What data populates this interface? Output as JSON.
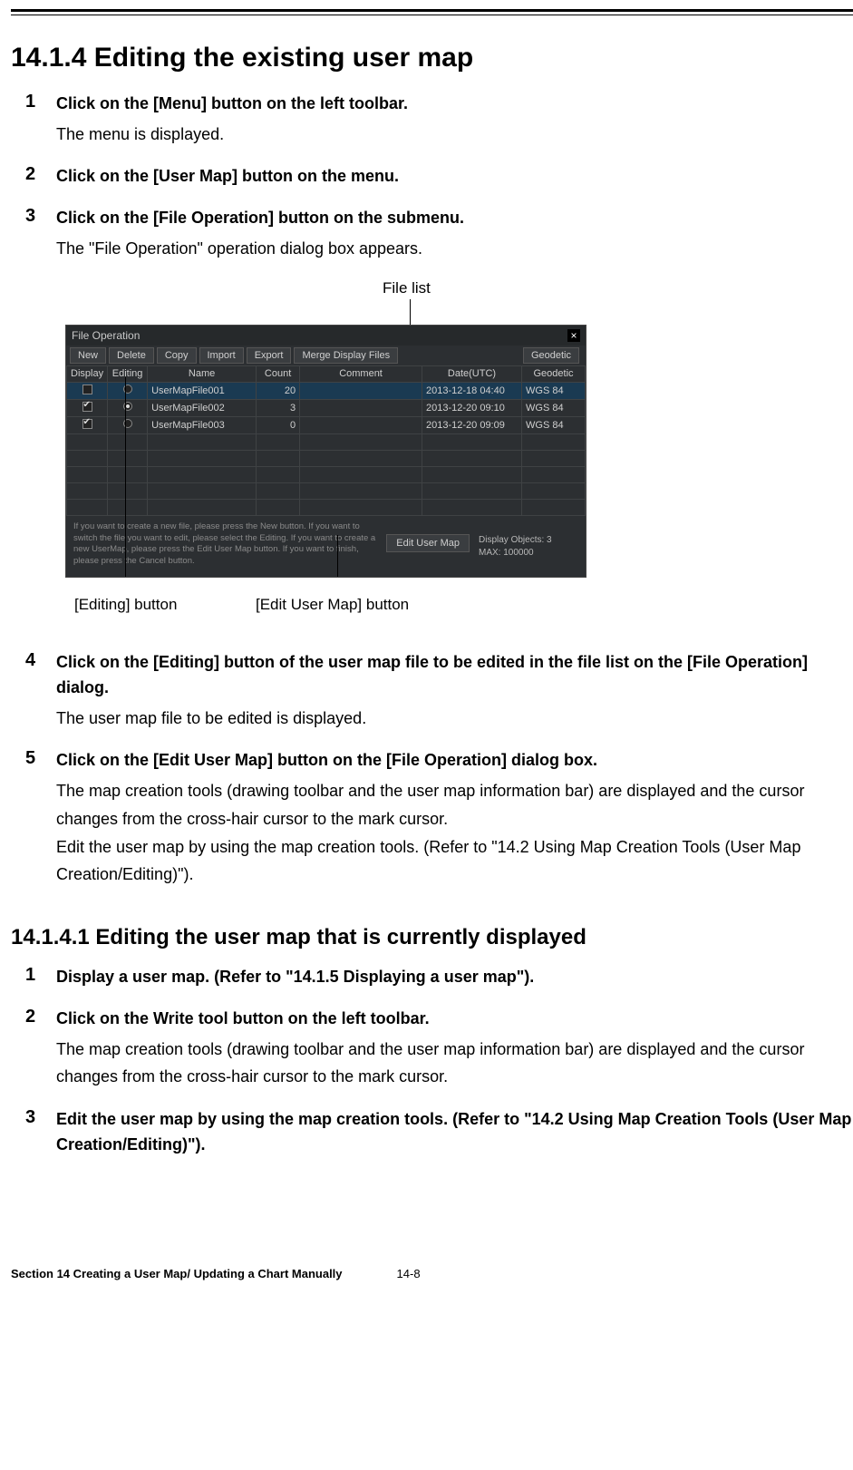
{
  "heading": "14.1.4   Editing the existing user map",
  "steps_a": [
    {
      "num": "1",
      "title": "Click on the [Menu] button on the left toolbar.",
      "body": "The menu is displayed."
    },
    {
      "num": "2",
      "title": "Click on the [User Map] button on the menu.",
      "body": ""
    },
    {
      "num": "3",
      "title": "Click on the [File Operation] button on the submenu.",
      "body": "The \"File Operation\" operation dialog box appears."
    }
  ],
  "callout_top": "File list",
  "dialog": {
    "title": "File Operation",
    "close": "×",
    "toolbar": {
      "new": "New",
      "delete": "Delete",
      "copy": "Copy",
      "import": "Import",
      "export": "Export",
      "merge": "Merge Display Files",
      "geodetic": "Geodetic"
    },
    "columns": {
      "display": "Display",
      "editing": "Editing",
      "name": "Name",
      "count": "Count",
      "comment": "Comment",
      "date": "Date(UTC)",
      "geodetic": "Geodetic"
    },
    "rows": [
      {
        "display": false,
        "editing": false,
        "name": "UserMapFile001",
        "count": "20",
        "comment": "",
        "date": "2013-12-18 04:40",
        "geodetic": "WGS 84",
        "selected": true
      },
      {
        "display": true,
        "editing": true,
        "name": "UserMapFile002",
        "count": "3",
        "comment": "",
        "date": "2013-12-20 09:10",
        "geodetic": "WGS 84",
        "selected": false
      },
      {
        "display": true,
        "editing": false,
        "name": "UserMapFile003",
        "count": "0",
        "comment": "",
        "date": "2013-12-20 09:09",
        "geodetic": "WGS 84",
        "selected": false
      }
    ],
    "help_text": "If you want to create a new file, please press the New button. If you want to switch the file you want to edit, please select the Editing. If you want to create a new UserMap, please press the Edit User Map button. If you want to finish, please press the Cancel button.",
    "edit_btn": "Edit User Map",
    "stats_line1": "Display Objects: 3",
    "stats_line2": "MAX: 100000"
  },
  "callout_editing": "[Editing] button",
  "callout_editmap": "[Edit User Map] button",
  "steps_b": [
    {
      "num": "4",
      "title": "Click on the [Editing] button of the user map file to be edited in the file list on the [File Operation] dialog.",
      "body": "The user map file to be edited is displayed."
    },
    {
      "num": "5",
      "title": "Click on the [Edit User Map] button on the [File Operation] dialog box.",
      "body": "The map creation tools (drawing toolbar and the user map information bar) are displayed and the cursor changes from the cross-hair cursor to the mark cursor.\nEdit the user map by using the map creation tools. (Refer to \"14.2 Using Map Creation Tools (User Map Creation/Editing)\")."
    }
  ],
  "subheading": "14.1.4.1    Editing the user map that is currently displayed",
  "steps_c": [
    {
      "num": "1",
      "title": "Display a user map. (Refer to \"14.1.5 Displaying a user map\").",
      "body": ""
    },
    {
      "num": "2",
      "title": "Click on the Write tool button on the left toolbar.",
      "body": "The map creation tools (drawing toolbar and the user map information bar) are displayed and the cursor changes from the cross-hair cursor to the mark cursor."
    },
    {
      "num": "3",
      "title": "Edit the user map by using the map creation tools. (Refer to \"14.2 Using Map Creation Tools (User Map Creation/Editing)\").",
      "body": ""
    }
  ],
  "footer": {
    "section": "Section 14    Creating a User Map/ Updating a Chart Manually",
    "page": "14-8"
  }
}
